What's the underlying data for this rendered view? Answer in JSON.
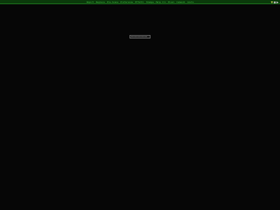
{
  "menu": {
    "items": [
      {
        "label": "Import"
      },
      {
        "label": "Replace"
      },
      {
        "label": "Pre-Scene"
      },
      {
        "label": "Preferenze"
      },
      {
        "label": "Effetti"
      },
      {
        "label": "Stampa"
      },
      {
        "label": "Help Cli"
      },
      {
        "label": "Pixel"
      },
      {
        "label": "Comandi"
      },
      {
        "label": "Aiuto"
      }
    ]
  },
  "window_controls": {
    "icons": [
      "minimize-icon",
      "maximize-icon",
      "close-icon"
    ],
    "colors": {
      "minimize": "#c8d44a",
      "maximize": "#c8c8c8",
      "close": "#c8c8c8"
    }
  },
  "colors": {
    "background": "#060606",
    "menubar": "#0b3a0b",
    "menu_text": "#4cd64c"
  },
  "loading": {
    "progress": 0.9
  }
}
